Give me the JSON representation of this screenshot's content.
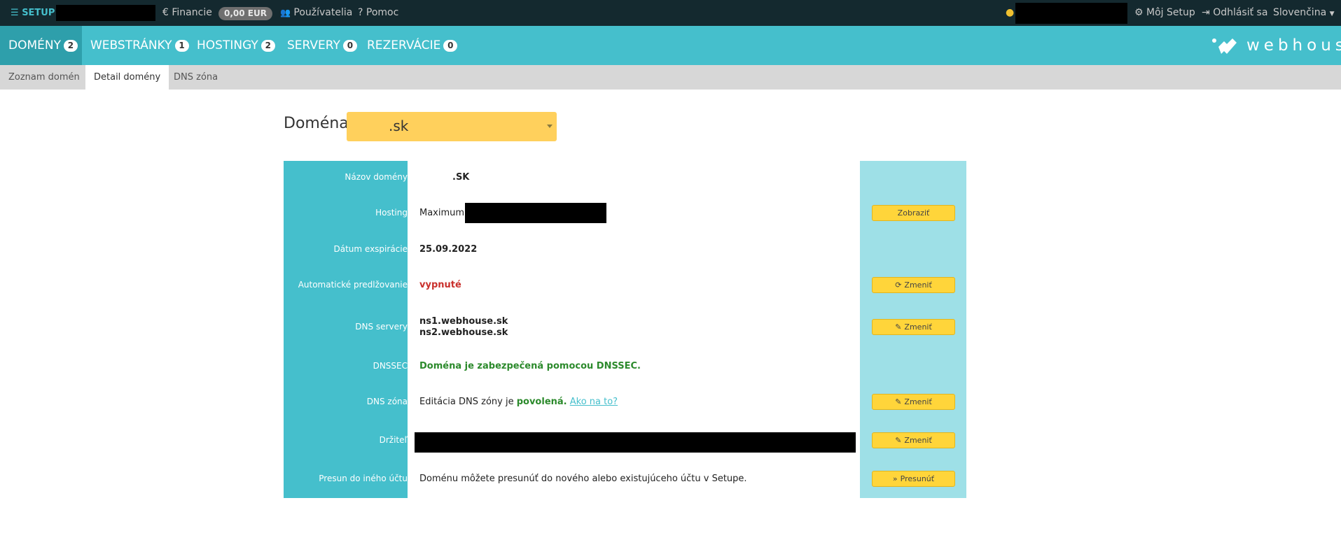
{
  "topbar": {
    "setup_label": "SETUP",
    "financie_label": "Financie",
    "balance": "0,00 EUR",
    "users_label": "Používatelia",
    "help_label": "Pomoc",
    "my_setup_label": "Môj Setup",
    "logout_label": "Odhlásiť sa",
    "language_label": "Slovenčina"
  },
  "mainnav": {
    "tabs": [
      {
        "label": "DOMÉNY",
        "count": "2"
      },
      {
        "label": "WEBSTRÁNKY",
        "count": "1"
      },
      {
        "label": "HOSTINGY",
        "count": "2"
      },
      {
        "label": "SERVERY",
        "count": "0"
      },
      {
        "label": "REZERVÁCIE",
        "count": "0"
      }
    ],
    "logo_text": "webhouse"
  },
  "subnav": {
    "tabs": [
      "Zoznam domén",
      "Detail domény",
      "DNS zóna"
    ]
  },
  "domain_selector": {
    "label": "Doména",
    "value": ".sk"
  },
  "details": {
    "rows": [
      {
        "label": "Názov domény",
        "value": ".SK"
      },
      {
        "label": "Hosting",
        "value": "Maximum",
        "button": "Zobraziť"
      },
      {
        "label": "Dátum exspirácie",
        "value": "25.09.2022"
      },
      {
        "label": "Automatické predlžovanie",
        "value": "vypnuté",
        "button": "Zmeniť"
      },
      {
        "label": "DNS servery",
        "value": "ns1.webhouse.sk",
        "value2": "ns2.webhouse.sk",
        "button": "Zmeniť"
      },
      {
        "label": "DNSSEC",
        "value": "Doména je zabezpečená pomocou DNSSEC."
      },
      {
        "label": "DNS zóna",
        "value_prefix": "Editácia DNS zóny je",
        "value_status": "povolená.",
        "value_link": "Ako na to?",
        "button": "Zmeniť"
      },
      {
        "label": "Držiteľ",
        "button": "Zmeniť"
      },
      {
        "label": "Presun do iného účtu",
        "value": "Doménu môžete presunúť do nového alebo existujúceho účtu v Setupe.",
        "button": "Presunúť"
      }
    ]
  },
  "colors": {
    "accent": "#45bfcc",
    "topbar_bg": "#14292f",
    "button_yellow": "#ffd53a",
    "status_off": "#c9302c",
    "status_on": "#2c8a2c"
  }
}
